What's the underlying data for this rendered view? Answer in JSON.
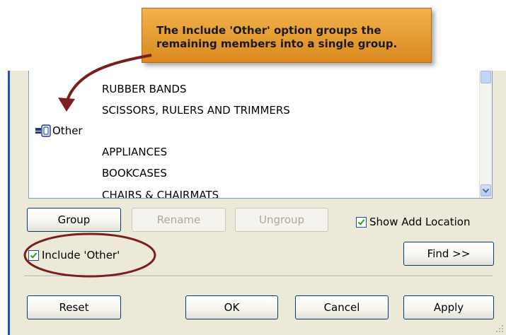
{
  "callout": {
    "line1": "The Include 'Other' option groups the",
    "line2": "remaining members into a single group."
  },
  "list": {
    "items": [
      {
        "label": "RUBBER BANDS",
        "kind": "member"
      },
      {
        "label": "SCISSORS, RULERS AND TRIMMERS",
        "kind": "member"
      },
      {
        "label": "Other",
        "kind": "group",
        "icon": "group-icon"
      },
      {
        "label": "APPLIANCES",
        "kind": "member"
      },
      {
        "label": "BOOKCASES",
        "kind": "member"
      },
      {
        "label": "CHAIRS & CHAIRMATS",
        "kind": "member"
      }
    ]
  },
  "buttons": {
    "group": "Group",
    "rename": "Rename",
    "ungroup": "Ungroup",
    "find": "Find >>",
    "reset": "Reset",
    "ok": "OK",
    "cancel": "Cancel",
    "apply": "Apply"
  },
  "checkboxes": {
    "show_add_location": {
      "label": "Show Add Location",
      "checked": true
    },
    "include_other": {
      "label": "Include 'Other'",
      "checked": true
    }
  },
  "colors": {
    "callout": "#e9a03a",
    "highlight_ring": "#7a1f1f",
    "check": "#21a121",
    "dialog_bg": "#ece9d8",
    "accent_edge": "#1a54d6"
  }
}
